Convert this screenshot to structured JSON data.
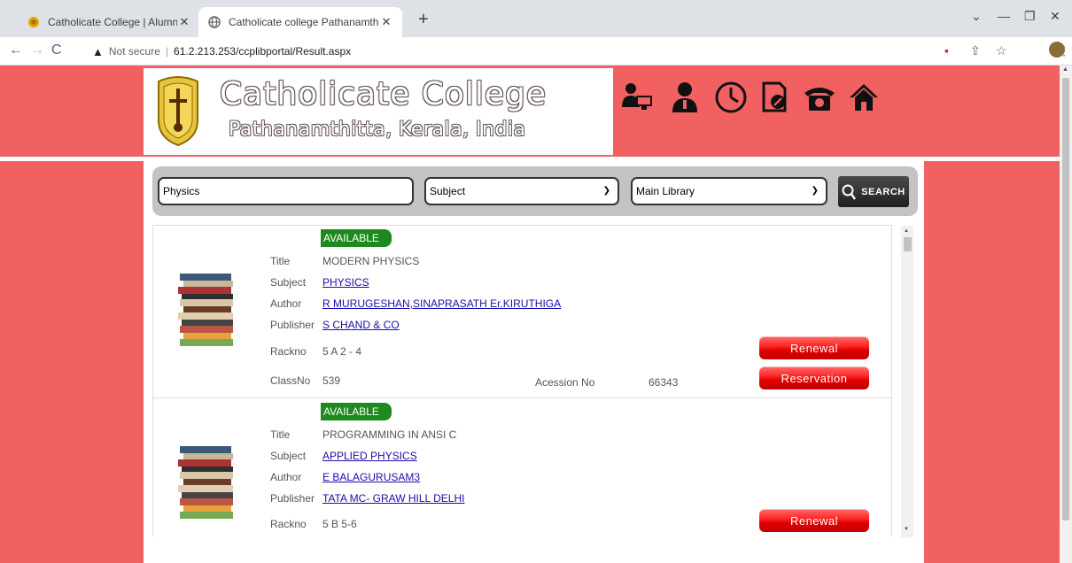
{
  "browser": {
    "tabs": [
      {
        "title": "Catholicate College | Alumni",
        "active": false
      },
      {
        "title": "Catholicate college Pathanamthit",
        "active": true
      }
    ],
    "security": "Not secure",
    "url": "61.2.213.253/ccplibportal/Result.aspx"
  },
  "header": {
    "college_name": "Catholicate College",
    "college_place": "Pathanamthitta, Kerala, India",
    "icons": [
      "users-computer-icon",
      "user-icon",
      "clock-icon",
      "document-edit-icon",
      "telephone-icon",
      "home-icon"
    ]
  },
  "search": {
    "query": "Physics",
    "field": "Subject",
    "library": "Main Library",
    "button": "SEARCH"
  },
  "results": [
    {
      "status": "AVAILABLE",
      "title_label": "Title",
      "title": "MODERN PHYSICS",
      "subject_label": "Subject",
      "subject": "PHYSICS",
      "author_label": "Author",
      "author": "R MURUGESHAN,SINAPRASATH Er.KIRUTHIGA",
      "publisher_label": "Publisher",
      "publisher": "S CHAND & CO",
      "rackno_label": "Rackno",
      "rackno": "5 A 2 - 4",
      "classno_label": "ClassNo",
      "classno": "539",
      "accession_label": "Acession No",
      "accession": "66343",
      "renewal": "Renewal",
      "reservation": "Reservation"
    },
    {
      "status": "AVAILABLE",
      "title_label": "Title",
      "title": "PROGRAMMING IN ANSI C",
      "subject_label": "Subject",
      "subject": "APPLIED PHYSICS",
      "author_label": "Author",
      "author": "E BALAGURUSAM3",
      "publisher_label": "Publisher",
      "publisher": "TATA MC- GRAW HILL DELHI",
      "rackno_label": "Rackno",
      "rackno": "5 B 5-6",
      "renewal": "Renewal"
    }
  ],
  "colors": {
    "page_bg": "#f26161",
    "available": "#1e8a1e",
    "button_red": "#e00000"
  }
}
